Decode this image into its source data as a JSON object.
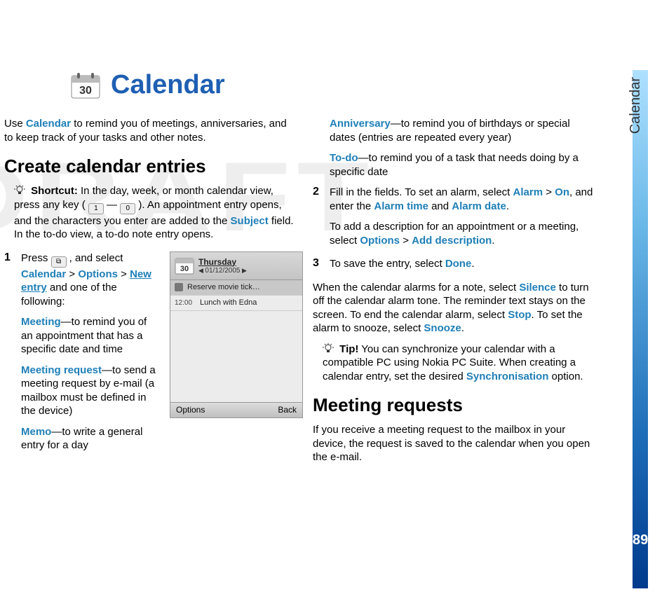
{
  "sidebar_label": "Calendar",
  "page_number": "89",
  "watermark": "DRAFT",
  "chapter_title": "Calendar",
  "intro": {
    "pre": "Use ",
    "term": "Calendar",
    "post": " to remind you of meetings, anniversaries, and to keep track of your tasks and other notes."
  },
  "h_create": "Create calendar entries",
  "shortcut": {
    "label": "Shortcut:",
    "part1": " In the day, week, or month calendar view, press any key ( ",
    "key1": "1",
    "dash": " — ",
    "key0": "0",
    "part2": " ). An appointment entry opens, and the characters you enter are added to the ",
    "subject": "Subject",
    "part3": " field. In the to-do view, a to-do note entry opens."
  },
  "step1": {
    "num": "1",
    "press": "Press ",
    "menu_key": "⧉",
    "sel": " , and select ",
    "calendar": "Calendar",
    "gt1": " > ",
    "options": "Options",
    "gt2": " > ",
    "newentry": "New entry",
    "follow": " and one of the following:",
    "meeting": "Meeting",
    "meeting_txt": "—to remind you of an appointment that has a specific date and time",
    "mreq": "Meeting request",
    "mreq_txt": "—to send a meeting request by e-mail (a mailbox must be defined in the device)",
    "memo": "Memo",
    "memo_txt": "—to write a general entry for a day"
  },
  "col2": {
    "anniv": "Anniversary",
    "anniv_txt": "—to remind you of birthdays or special dates (entries are repeated every year)",
    "todo": "To-do",
    "todo_txt": "—to remind you of a task that needs doing by a specific date"
  },
  "step2": {
    "num": "2",
    "t1": "Fill in the fields. To set an alarm, select ",
    "alarm": "Alarm",
    "gt": " > ",
    "on": "On",
    "t2": ", and enter the ",
    "alarmtime": "Alarm time",
    "and": " and ",
    "alarmdate": "Alarm date",
    "t3": ".",
    "t4": "To add a description for an appointment or a meeting, select ",
    "options": "Options",
    "gt2": " > ",
    "adddesc": "Add description",
    "t5": "."
  },
  "step3": {
    "num": "3",
    "t1": "To save the entry, select ",
    "done": "Done",
    "t2": "."
  },
  "alarm_para": {
    "t1": "When the calendar alarms for a note, select ",
    "silence": "Silence",
    "t2": " to turn off the calendar alarm tone. The reminder text stays on the screen. To end the calendar alarm, select ",
    "stop": "Stop",
    "t3": ". To set the alarm to snooze, select ",
    "snooze": "Snooze",
    "t4": "."
  },
  "tip": {
    "label": "Tip!",
    "t1": " You can synchronize your calendar with a compatible PC using Nokia PC Suite. When creating a calendar entry, set the desired ",
    "sync": "Synchronisation",
    "t2": " option."
  },
  "h_meeting": "Meeting requests",
  "meeting_intro": "If you receive a meeting request to the mailbox in your device, the request is saved to the calendar when you open the e-mail.",
  "screenshot": {
    "day": "Thursday",
    "date": "01/12/2005",
    "row1": "Reserve movie tick…",
    "row2_time": "12:00",
    "row2_text": "Lunch with Edna",
    "sk_left": "Options",
    "sk_right": "Back"
  }
}
